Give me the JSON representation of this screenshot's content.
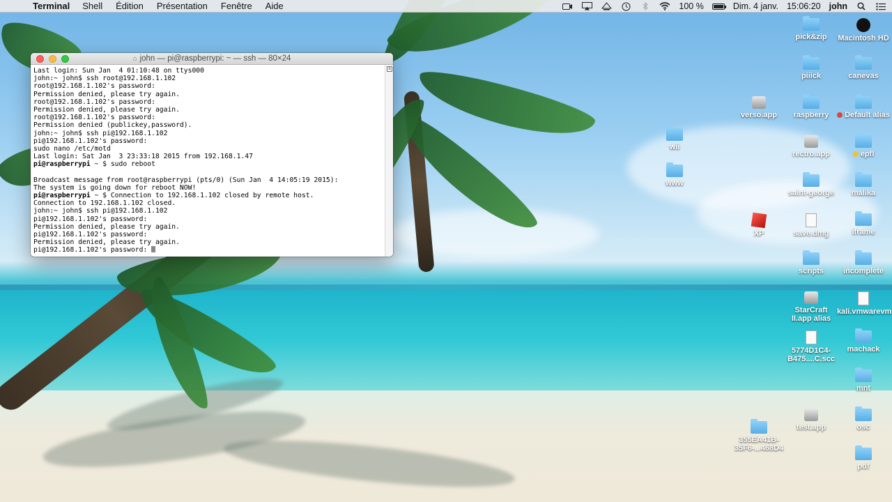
{
  "menubar": {
    "apple_glyph": "",
    "app_name": "Terminal",
    "menus": [
      "Shell",
      "Édition",
      "Présentation",
      "Fenêtre",
      "Aide"
    ],
    "battery_percent": "100 %",
    "battery_level": 1.0,
    "date": "Dim. 4 janv.",
    "time": "15:06:20",
    "user": "john",
    "status_icons": [
      "camera-icon",
      "airplay-icon",
      "display-icon",
      "time-machine-icon",
      "bluetooth-icon",
      "wifi-icon",
      "battery-icon",
      "search-icon"
    ]
  },
  "terminal": {
    "title": "john — pi@raspberrypi: ~ — ssh — 80×24",
    "lines": [
      {
        "text": "Last login: Sun Jan  4 01:10:48 on ttys000"
      },
      {
        "text": "john:~ john$ ssh root@192.168.1.102"
      },
      {
        "text": "root@192.168.1.102's password:"
      },
      {
        "text": "Permission denied, please try again."
      },
      {
        "text": "root@192.168.1.102's password:"
      },
      {
        "text": "Permission denied, please try again."
      },
      {
        "text": "root@192.168.1.102's password:"
      },
      {
        "text": "Permission denied (publickey,password)."
      },
      {
        "text": "john:~ john$ ssh pi@192.168.1.102"
      },
      {
        "text": "pi@192.168.1.102's password:"
      },
      {
        "text": "sudo nano /etc/motd"
      },
      {
        "text": "Last login: Sat Jan  3 23:33:18 2015 from 192.168.1.47"
      },
      {
        "prompt": "pi@raspberrypi",
        "text": " ~ $ sudo reboot"
      },
      {
        "text": ""
      },
      {
        "text": "Broadcast message from root@raspberrypi (pts/0) (Sun Jan  4 14:05:19 2015):"
      },
      {
        "text": "The system is going down for reboot NOW!"
      },
      {
        "prompt": "pi@raspberrypi",
        "text": " ~ $ Connection to 192.168.1.102 closed by remote host."
      },
      {
        "text": "Connection to 192.168.1.102 closed."
      },
      {
        "text": "john:~ john$ ssh pi@192.168.1.102"
      },
      {
        "text": "pi@192.168.1.102's password:"
      },
      {
        "text": "Permission denied, please try again."
      },
      {
        "text": "pi@192.168.1.102's password:"
      },
      {
        "text": "Permission denied, please try again."
      },
      {
        "text": "pi@192.168.1.102's password: ",
        "cursor": true
      }
    ]
  },
  "desktop": {
    "icons": [
      {
        "label": "pick&zip",
        "kind": "folder",
        "name": "desktop-icon-pick-zip"
      },
      {
        "label": "Macintosh HD",
        "kind": "disk",
        "name": "desktop-icon-macintosh-hd"
      },
      {
        "label": "piiick",
        "kind": "folder",
        "name": "desktop-icon-piiick"
      },
      {
        "label": "canevas",
        "kind": "folder",
        "name": "desktop-icon-canevas"
      },
      {
        "label": "verso.app",
        "kind": "app",
        "name": "desktop-icon-verso-app"
      },
      {
        "label": "raspberry",
        "kind": "folder",
        "name": "desktop-icon-raspberry"
      },
      {
        "label": "Default alias",
        "kind": "folder",
        "tag": "#e0443e",
        "name": "desktop-icon-default-alias"
      },
      {
        "label": "wii",
        "kind": "folder",
        "name": "desktop-icon-wii"
      },
      {
        "label": "rectro.app",
        "kind": "app",
        "name": "desktop-icon-rectro-app"
      },
      {
        "label": "epfl",
        "kind": "folder",
        "tag": "#f2c230",
        "name": "desktop-icon-epfl"
      },
      {
        "label": "www",
        "kind": "folder",
        "name": "desktop-icon-www"
      },
      {
        "label": "saint-george",
        "kind": "folder",
        "name": "desktop-icon-saint-george"
      },
      {
        "label": "malika",
        "kind": "folder",
        "name": "desktop-icon-malika"
      },
      {
        "label": "XP",
        "kind": "vm",
        "name": "desktop-icon-xp"
      },
      {
        "label": "save.dmg",
        "kind": "doc",
        "name": "desktop-icon-save-dmg"
      },
      {
        "label": "iframe",
        "kind": "folder",
        "name": "desktop-icon-iframe"
      },
      {
        "label": "scripts",
        "kind": "folder",
        "name": "desktop-icon-scripts"
      },
      {
        "label": "incomplete",
        "kind": "folder",
        "name": "desktop-icon-incomplete"
      },
      {
        "label": "StarCraft II.app alias",
        "kind": "app",
        "name": "desktop-icon-starcraft"
      },
      {
        "label": "kali.vmwarevm",
        "kind": "doc",
        "name": "desktop-icon-kali"
      },
      {
        "label": "5774D1C4-B475....C.scc",
        "kind": "doc",
        "name": "desktop-icon-scc-file"
      },
      {
        "label": "machack",
        "kind": "folder",
        "name": "desktop-icon-machack"
      },
      {
        "label": "mnt",
        "kind": "folder",
        "name": "desktop-icon-mnt"
      },
      {
        "label": "test.app",
        "kind": "app",
        "name": "desktop-icon-test-app"
      },
      {
        "label": "osc",
        "kind": "folder",
        "name": "desktop-icon-osc"
      },
      {
        "label": "355EA41B-35F6-...468D4",
        "kind": "folder",
        "name": "desktop-icon-355ea41b"
      },
      {
        "label": "pdf",
        "kind": "folder",
        "name": "desktop-icon-pdf"
      }
    ]
  }
}
